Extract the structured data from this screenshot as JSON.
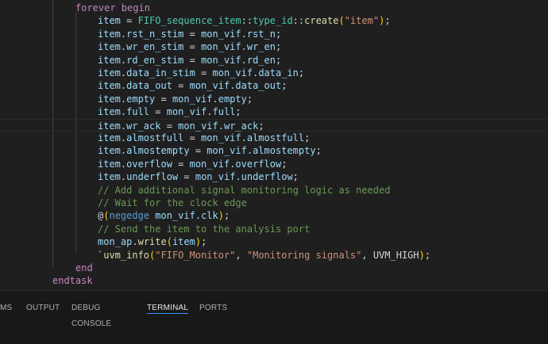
{
  "code_lines": [
    {
      "tokens": [
        {
          "t": "forever begin",
          "c": "kw"
        }
      ]
    },
    {
      "tokens": [
        {
          "t": "item",
          "c": "var"
        },
        {
          "t": " = ",
          "c": "plain"
        },
        {
          "t": "FIFO_sequence_item",
          "c": "type"
        },
        {
          "t": "::",
          "c": "plain"
        },
        {
          "t": "type_id",
          "c": "type"
        },
        {
          "t": "::",
          "c": "plain"
        },
        {
          "t": "create",
          "c": "fn"
        },
        {
          "t": "(",
          "c": "gold"
        },
        {
          "t": "\"item\"",
          "c": "str"
        },
        {
          "t": ")",
          "c": "gold"
        },
        {
          "t": ";",
          "c": "plain"
        }
      ]
    },
    {
      "tokens": [
        {
          "t": "item.rst_n_stim",
          "c": "var"
        },
        {
          "t": " = ",
          "c": "plain"
        },
        {
          "t": "mon_vif.rst_n",
          "c": "var"
        },
        {
          "t": ";",
          "c": "plain"
        }
      ]
    },
    {
      "tokens": [
        {
          "t": "item.wr_en_stim",
          "c": "var"
        },
        {
          "t": " = ",
          "c": "plain"
        },
        {
          "t": "mon_vif.wr_en",
          "c": "var"
        },
        {
          "t": ";",
          "c": "plain"
        }
      ]
    },
    {
      "tokens": [
        {
          "t": "item.rd_en_stim",
          "c": "var"
        },
        {
          "t": " = ",
          "c": "plain"
        },
        {
          "t": "mon_vif.rd_en",
          "c": "var"
        },
        {
          "t": ";",
          "c": "plain"
        }
      ]
    },
    {
      "tokens": [
        {
          "t": "item.data_in_stim",
          "c": "var"
        },
        {
          "t": " = ",
          "c": "plain"
        },
        {
          "t": "mon_vif.data_in",
          "c": "var"
        },
        {
          "t": ";",
          "c": "plain"
        }
      ]
    },
    {
      "tokens": [
        {
          "t": "item.data_out",
          "c": "var"
        },
        {
          "t": " = ",
          "c": "plain"
        },
        {
          "t": "mon_vif.data_out",
          "c": "var"
        },
        {
          "t": ";",
          "c": "plain"
        }
      ]
    },
    {
      "tokens": [
        {
          "t": "item.empty",
          "c": "var"
        },
        {
          "t": " = ",
          "c": "plain"
        },
        {
          "t": "mon_vif.empty",
          "c": "var"
        },
        {
          "t": ";",
          "c": "plain"
        }
      ]
    },
    {
      "tokens": [
        {
          "t": "item.full",
          "c": "var"
        },
        {
          "t": " = ",
          "c": "plain"
        },
        {
          "t": "mon_vif.full",
          "c": "var"
        },
        {
          "t": ";",
          "c": "plain"
        }
      ]
    },
    {
      "tokens": [
        {
          "t": "item.wr_ack",
          "c": "var"
        },
        {
          "t": " = ",
          "c": "plain"
        },
        {
          "t": "mon_vif.wr_ack",
          "c": "var"
        },
        {
          "t": ";",
          "c": "plain"
        }
      ],
      "current": true
    },
    {
      "tokens": [
        {
          "t": "item.almostfull",
          "c": "var"
        },
        {
          "t": " = ",
          "c": "plain"
        },
        {
          "t": "mon_vif.almostfull",
          "c": "var"
        },
        {
          "t": ";",
          "c": "plain"
        }
      ]
    },
    {
      "tokens": [
        {
          "t": "item.almostempty",
          "c": "var"
        },
        {
          "t": " = ",
          "c": "plain"
        },
        {
          "t": "mon_vif.almostempty",
          "c": "var"
        },
        {
          "t": ";",
          "c": "plain"
        }
      ]
    },
    {
      "tokens": [
        {
          "t": "item.overflow",
          "c": "var"
        },
        {
          "t": " = ",
          "c": "plain"
        },
        {
          "t": "mon_vif.overflow",
          "c": "var"
        },
        {
          "t": ";",
          "c": "plain"
        }
      ]
    },
    {
      "tokens": [
        {
          "t": "item.underflow",
          "c": "var"
        },
        {
          "t": " = ",
          "c": "plain"
        },
        {
          "t": "mon_vif.underflow",
          "c": "var"
        },
        {
          "t": ";",
          "c": "plain"
        }
      ]
    },
    {
      "tokens": [
        {
          "t": "// Add additional signal monitoring logic as needed",
          "c": "cmt"
        }
      ]
    },
    {
      "tokens": [
        {
          "t": "// Wait for the clock edge",
          "c": "cmt"
        }
      ]
    },
    {
      "tokens": [
        {
          "t": "@",
          "c": "plain"
        },
        {
          "t": "(",
          "c": "gold"
        },
        {
          "t": "negedge",
          "c": "blue"
        },
        {
          "t": " mon_vif.clk",
          "c": "var"
        },
        {
          "t": ")",
          "c": "gold"
        },
        {
          "t": ";",
          "c": "plain"
        }
      ]
    },
    {
      "tokens": [
        {
          "t": "// Send the item to the analysis port",
          "c": "cmt"
        }
      ]
    },
    {
      "tokens": [
        {
          "t": "mon_ap",
          "c": "var"
        },
        {
          "t": ".",
          "c": "plain"
        },
        {
          "t": "write",
          "c": "fn"
        },
        {
          "t": "(",
          "c": "gold"
        },
        {
          "t": "item",
          "c": "var"
        },
        {
          "t": ")",
          "c": "gold"
        },
        {
          "t": ";",
          "c": "plain"
        }
      ]
    },
    {
      "tokens": [
        {
          "t": "`uvm_info",
          "c": "fn"
        },
        {
          "t": "(",
          "c": "gold"
        },
        {
          "t": "\"FIFO_Monitor\"",
          "c": "str"
        },
        {
          "t": ", ",
          "c": "plain"
        },
        {
          "t": "\"Monitoring signals\"",
          "c": "str"
        },
        {
          "t": ", ",
          "c": "plain"
        },
        {
          "t": "UVM_HIGH",
          "c": "plain"
        },
        {
          "t": ")",
          "c": "gold"
        },
        {
          "t": ";",
          "c": "plain"
        }
      ]
    },
    {
      "tokens": [
        {
          "t": "end",
          "c": "kw"
        }
      ]
    },
    {
      "tokens": [
        {
          "t": "endtask",
          "c": "kw"
        }
      ]
    }
  ],
  "panel": {
    "tabs": [
      {
        "label": "MS",
        "name": "tab-problems"
      },
      {
        "label": "OUTPUT",
        "name": "tab-output"
      },
      {
        "label": "DEBUG CONSOLE",
        "name": "tab-debug-console"
      },
      {
        "label": "TERMINAL",
        "name": "tab-terminal",
        "active": true
      },
      {
        "label": "PORTS",
        "name": "tab-ports"
      }
    ]
  },
  "colors": {
    "editor_bg": "#1f1f1f",
    "keyword": "#c586c0",
    "variable": "#9cdcfe",
    "type": "#4ec9b0",
    "function": "#dcdcaa",
    "string": "#ce9178",
    "comment": "#6a9955",
    "accent": "#3794ff"
  }
}
